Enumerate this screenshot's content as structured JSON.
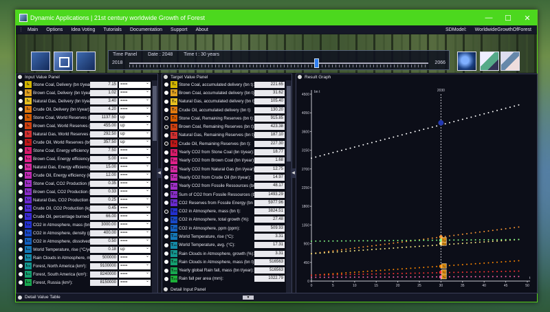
{
  "window": {
    "title": "Dynamic Applications | 21st century worldwide Growth of Forest",
    "controls": [
      "—",
      "☐",
      "✕"
    ]
  },
  "menu": {
    "items": [
      "Main",
      "Options",
      "Idea Voting",
      "Tutorials",
      "Documentation",
      "Support",
      "About"
    ],
    "right_label": "SDModel:",
    "right_value": "WorldwideGrowthOfForest"
  },
  "time_panel": {
    "title": "Time Panel",
    "date_label": "Date : 2048",
    "time_label": "Time t : 30  years",
    "start_year": "2018",
    "end_year": "2066",
    "position": 0.625
  },
  "input_panel": {
    "title": "Input Value Panel",
    "rows": [
      {
        "label": "Stone Coal, Delivery (bn t/year):",
        "value": "7.15",
        "option": "===",
        "color": "#d4b600",
        "sym": "I₁",
        "selected": false
      },
      {
        "label": "Brown Coal, Delivery (bn t/year):",
        "value": "1.02",
        "option": "===",
        "color": "#e0a020",
        "sym": "I₂",
        "selected": false
      },
      {
        "label": "Natural Gas, Delivery (bn t/year):",
        "value": "3.40",
        "option": "===",
        "color": "#e8c020",
        "sym": "I₃",
        "selected": false
      },
      {
        "label": "Crude Oil, Delivery (bn t/year):",
        "value": "4.20",
        "option": "===",
        "color": "#e07b10",
        "sym": "I₄",
        "selected": false
      },
      {
        "label": "Stone Coal, World Reserves (bn t):",
        "value": "1137.50",
        "option": "up",
        "color": "#d35a00",
        "sym": "I₅",
        "selected": false
      },
      {
        "label": "Brown Coal, World Reserves (bn t):",
        "value": "455.00",
        "option": "up",
        "color": "#d04010",
        "sym": "I₆",
        "selected": false
      },
      {
        "label": "Natural Gas, World Reserves (bn t):",
        "value": "292.50",
        "option": "up",
        "color": "#d23030",
        "sym": "I₇",
        "selected": false
      },
      {
        "label": "Crude Oil, World Reserves (bn t):",
        "value": "357.50",
        "option": "up",
        "color": "#c01818",
        "sym": "I₈",
        "selected": false
      },
      {
        "label": "Stone Coal, Energy efficiency (kWh/kg):",
        "value": "7.50",
        "option": "===",
        "color": "#d81b6a",
        "sym": "I₉",
        "selected": false
      },
      {
        "label": "Brown Coal, Energy efficiency (kWh/kg):",
        "value": "5.00",
        "option": "===",
        "color": "#e0208a",
        "sym": "I₁₀",
        "selected": false
      },
      {
        "label": "Natural Gas, Energy efficiency (kWh/kg):",
        "value": "15.00",
        "option": "===",
        "color": "#d42a9e",
        "sym": "I₁₁",
        "selected": false
      },
      {
        "label": "Crude Oil, Energy efficiency (kWh/kg):",
        "value": "12.00",
        "option": "===",
        "color": "#c02ab4",
        "sym": "I₁₂",
        "selected": false
      },
      {
        "label": "Stone Coal, CO2 Production (kg/kg):",
        "value": "0.35",
        "option": "===",
        "color": "#a030c8",
        "sym": "I₁₃",
        "selected": false
      },
      {
        "label": "Brown Coal, CO2 Production (kg/kg):",
        "value": "0.33",
        "option": "===",
        "color": "#8a2ec8",
        "sym": "I₁₄",
        "selected": false
      },
      {
        "label": "Natural Gas, CO2 Production (kg/kg):",
        "value": "0.25",
        "option": "===",
        "color": "#6a2ad0",
        "sym": "I₁₅",
        "selected": false
      },
      {
        "label": "Crude Oil, CO2 Production (kg/kg):",
        "value": "0.45",
        "option": "===",
        "color": "#4e2ad4",
        "sym": "I₁₆",
        "selected": false
      },
      {
        "label": "Crude Oil, percentage burned (%):",
        "value": "66.00",
        "option": "===",
        "color": "#3a2ad8",
        "sym": "I₁₇",
        "selected": false
      },
      {
        "label": "CO2 in Atmosphere, mass (bn t):",
        "value": "3000.00",
        "option": "===",
        "color": "#2230d0",
        "sym": "I₁₈",
        "selected": false
      },
      {
        "label": "CO2 in Atmosphere, density (ppm):",
        "value": "400.00",
        "option": "===",
        "color": "#1848c8",
        "sym": "I₁₉",
        "selected": false
      },
      {
        "label": "CO2 in Atmosphere, dissolved (%):",
        "value": "0.50",
        "option": "===",
        "color": "#1460c0",
        "sym": "I₂₀",
        "selected": false
      },
      {
        "label": "World Temperature, rise (°C/year):",
        "value": "0.18",
        "option": "up",
        "color": "#1478b8",
        "sym": "I₂₁",
        "selected": false
      },
      {
        "label": "Rain Clouds in Atmosphere, mass (bn t):",
        "value": "500000",
        "option": "===",
        "color": "#148aa8",
        "sym": "I₂₂",
        "selected": false
      },
      {
        "label": "Forest, North America (km²):",
        "value": "9100000",
        "option": "===",
        "color": "#149890",
        "sym": "I₂₃",
        "selected": false
      },
      {
        "label": "Forest, South America (km²):",
        "value": "8240000",
        "option": "===",
        "color": "#14a070",
        "sym": "I₂₄",
        "selected": false
      },
      {
        "label": "Forest, Russia (km²):",
        "value": "8150000",
        "option": "===",
        "color": "#18a850",
        "sym": "I₂₅",
        "selected": false
      }
    ]
  },
  "target_panel": {
    "title": "Target Value Panel",
    "rows": [
      {
        "label": "Stone Coal, accumulated delivery (bn t):",
        "value": "221.65",
        "color": "#d4b600",
        "sym": "T₁",
        "selected": false
      },
      {
        "label": "Brown Coal, accumulated delivery (bn t):",
        "value": "31.62",
        "color": "#e0a020",
        "sym": "T₂",
        "selected": false
      },
      {
        "label": "Natural Gas, accumulated delivery (bn t):",
        "value": "105.40",
        "color": "#e8c020",
        "sym": "T₃",
        "selected": false
      },
      {
        "label": "Crude Oil, accumulated delivery (bn t):",
        "value": "130.20",
        "color": "#e07b10",
        "sym": "T₄",
        "selected": false
      },
      {
        "label": "Stone Coal, Remaining Reserves (bn t):",
        "value": "915.85",
        "color": "#d35a00",
        "sym": "T₅",
        "selected": true
      },
      {
        "label": "Brown Coal, Remaining Reserves (bn t):",
        "value": "423.38",
        "color": "#d04010",
        "sym": "T₆",
        "selected": true
      },
      {
        "label": "Natural Gas, Remaining Reserves (bn t):",
        "value": "187.10",
        "color": "#d23030",
        "sym": "T₇",
        "selected": false
      },
      {
        "label": "Crude Oil, Remaining Reserves (bn t):",
        "value": "227.30",
        "color": "#c01818",
        "sym": "T₈",
        "selected": true
      },
      {
        "label": "Yearly CO2 from Stone Coal (bn t/year):",
        "value": "18.77",
        "color": "#d81b6a",
        "sym": "T₉",
        "selected": false
      },
      {
        "label": "Yearly CO2 from Brown Coal (bn t/year):",
        "value": "1.68",
        "color": "#e0208a",
        "sym": "T₁₀",
        "selected": false
      },
      {
        "label": "Yearly CO2 from Natural Gas (bn t/year):",
        "value": "12.75",
        "color": "#d42a9e",
        "sym": "T₁₁",
        "selected": false
      },
      {
        "label": "Yearly CO2 from Crude Oil (bn t/year):",
        "value": "14.97",
        "color": "#c02ab4",
        "sym": "T₁₂",
        "selected": false
      },
      {
        "label": "Yearly CO2 from Fossile Ressources (bn t):",
        "value": "48.17",
        "color": "#a030c8",
        "sym": "T₁₃",
        "selected": false
      },
      {
        "label": "Sum of CO2 from Fossile Ressources (bn t):",
        "value": "1493.29",
        "color": "#8a2ec8",
        "sym": "T₁₄",
        "selected": false
      },
      {
        "label": "CO2 Reserves from Fossile Energy (bn t):",
        "value": "5977.96",
        "color": "#6a2ad0",
        "sym": "T₁₅",
        "selected": false
      },
      {
        "label": "CO2 in Atmosphere, mass (bn t):",
        "value": "3824.51",
        "color": "#2230d0",
        "sym": "T₁₆",
        "selected": true
      },
      {
        "label": "CO2 in Atmosphere, total growth (%):",
        "value": "27.48",
        "color": "#1848c8",
        "sym": "T₁₇",
        "selected": false
      },
      {
        "label": "CO2 in Atmosphere, ppm (ppm):",
        "value": "509.93",
        "color": "#1460c0",
        "sym": "T₁₈",
        "selected": false
      },
      {
        "label": "World Temperature, rise (°C):",
        "value": "3.31",
        "color": "#1478b8",
        "sym": "T₁₉",
        "selected": false
      },
      {
        "label": "World Temperature, avg. (°C):",
        "value": "17.31",
        "color": "#148aa8",
        "sym": "T₂₀",
        "selected": false
      },
      {
        "label": "Rain Clouds in Atmosphere, growth (%):",
        "value": "3.31",
        "color": "#149890",
        "sym": "T₂₁",
        "selected": false
      },
      {
        "label": "Rain Clouds in Atmosphere, mass (bn t):",
        "value": "516563",
        "color": "#14a070",
        "sym": "T₂₂",
        "selected": false
      },
      {
        "label": "Yearly global Rain fall, mass (bn t/year):",
        "value": "516563",
        "color": "#18a850",
        "sym": "T₂₃",
        "selected": false
      },
      {
        "label": "Rain fall per area (mm):",
        "value": "1022.79",
        "color": "#1cb038",
        "sym": "T₂₄",
        "selected": false
      }
    ]
  },
  "result_graph": {
    "title": "Result Graph",
    "current_t": "30",
    "current_year": "2030"
  },
  "chart_data": {
    "type": "scatter",
    "xlabel": "t",
    "ylabel": "bn t",
    "xlim": [
      0,
      50
    ],
    "ylim": [
      0,
      4500
    ],
    "x_ticks": [
      "0",
      "5",
      "10",
      "15",
      "20",
      "25",
      "30",
      "35",
      "40",
      "45",
      "50"
    ],
    "y_ticks": [
      "0",
      "450",
      "900",
      "1350",
      "1800",
      "2250",
      "2700",
      "3150",
      "3600",
      "4050",
      "4500"
    ],
    "marker_x": 30,
    "series": [
      {
        "color": "#ffffff",
        "x0": 0,
        "y0": 2960,
        "x1": 48,
        "y1": 4240,
        "highlight": 3810,
        "badge": ""
      },
      {
        "color": "#ff9933",
        "x0": 0,
        "y0": 660,
        "x1": 48,
        "y1": 1300,
        "highlight": 1065,
        "badge": ""
      },
      {
        "color": "#ffee88",
        "x0": 0,
        "y0": 660,
        "x1": 48,
        "y1": 1000,
        "highlight": 905,
        "badge": "T₁₉"
      },
      {
        "color": "#88ff88",
        "x0": 0,
        "y0": 960,
        "x1": 48,
        "y1": 1000,
        "highlight": 985,
        "badge": "T₁₆"
      },
      {
        "color": "#ff8800",
        "x0": 0,
        "y0": 140,
        "x1": 48,
        "y1": 490,
        "highlight": 355,
        "badge": "T₆"
      },
      {
        "color": "#ff3333",
        "x0": 0,
        "y0": 140,
        "x1": 48,
        "y1": 240,
        "highlight": 210,
        "badge": "T₅"
      },
      {
        "color": "#ff66aa",
        "x0": 0,
        "y0": 90,
        "x1": 48,
        "y1": 110,
        "highlight": 100,
        "badge": "T₈"
      }
    ]
  },
  "bottom": {
    "detail_value_table": "Detail Value Table",
    "detail_input_panel": "Detail Input Panel"
  }
}
